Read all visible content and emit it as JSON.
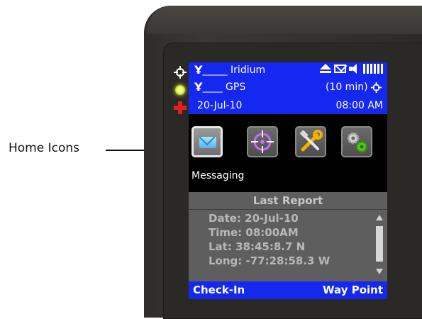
{
  "callout": {
    "label": "Home Icons"
  },
  "status": {
    "iridium_dashes": "_____",
    "iridium_label": "Iridium",
    "gps_dashes": "____",
    "gps_label": "GPS",
    "interval": "(10 min)",
    "date": "20-Jul-10",
    "time": "08:00 AM"
  },
  "home": {
    "icons": [
      {
        "name": "messaging-icon"
      },
      {
        "name": "waypoint-icon"
      },
      {
        "name": "tools-icon"
      },
      {
        "name": "settings-icon"
      }
    ],
    "selected_label": "Messaging"
  },
  "report": {
    "title": "Last Report",
    "date": "Date: 20-Jul-10",
    "time": "Time: 08:00AM",
    "lat": "Lat: 38:45:8.7 N",
    "long": "Long: -77:28:58.3 W"
  },
  "softkeys": {
    "left": "Check-In",
    "right": "Way Point"
  },
  "colors": {
    "status_bar": "#1428f0",
    "report_bg": "#5e5e5e",
    "led": "#d4f000",
    "sos": "#e41f1f"
  }
}
